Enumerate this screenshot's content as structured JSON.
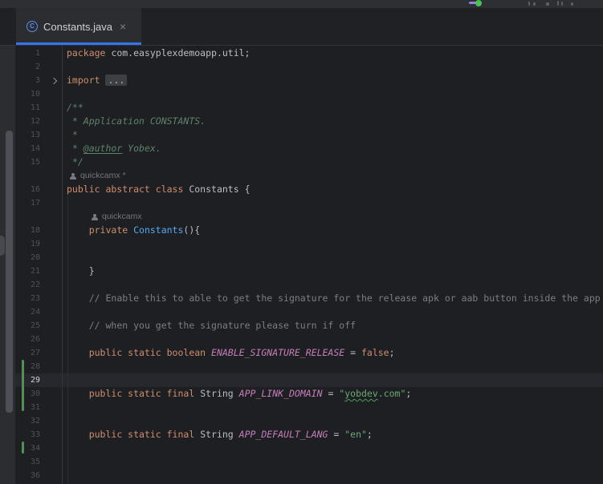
{
  "theme": {
    "accent": "#3574f0",
    "editor_bg": "#1e1f22",
    "panel_bg": "#2b2d30",
    "keyword_color": "#cf8e6d",
    "string_color": "#6aab73",
    "comment_color": "#7a7e85",
    "doc_comment_color": "#5f826b",
    "static_field_color": "#c77dbb",
    "method_color": "#56a8f5",
    "change_marker_color": "#549159",
    "run_dot_color": "#4cc152"
  },
  "tab": {
    "title": "Constants.java",
    "icon_letter": "C",
    "close_glyph": "×"
  },
  "editor": {
    "caret_line": 29,
    "changed_line_ranges": [
      [
        28,
        31
      ],
      [
        34,
        34
      ]
    ],
    "folded_region": "import lines 4-9",
    "rows": [
      {
        "ln": "1",
        "seg": [
          [
            "k",
            "package "
          ],
          [
            "p",
            "com.easyplexdemoapp.util;"
          ]
        ]
      },
      {
        "ln": "2",
        "seg": []
      },
      {
        "ln": "3",
        "fold": true,
        "seg": [
          [
            "k",
            "import "
          ],
          [
            "chip",
            "..."
          ]
        ]
      },
      {
        "ln": "10",
        "seg": []
      },
      {
        "ln": "11",
        "seg": [
          [
            "d",
            "/**"
          ]
        ]
      },
      {
        "ln": "12",
        "seg": [
          [
            "d",
            " * Application CONSTANTS."
          ]
        ]
      },
      {
        "ln": "13",
        "seg": [
          [
            "d",
            " *"
          ]
        ]
      },
      {
        "ln": "14",
        "seg": [
          [
            "d",
            " * "
          ],
          [
            "dt",
            "@author"
          ],
          [
            "d",
            " Yobex."
          ]
        ]
      },
      {
        "ln": "15",
        "seg": [
          [
            "d",
            " */"
          ]
        ]
      },
      {
        "ln": null,
        "inlay": "quickcamx *",
        "indent": 0
      },
      {
        "ln": "16",
        "seg": [
          [
            "k",
            "public abstract class "
          ],
          [
            "p",
            "Constants {"
          ]
        ]
      },
      {
        "ln": "17",
        "seg": []
      },
      {
        "ln": null,
        "inlay": "quickcamx",
        "indent": 1
      },
      {
        "ln": "18",
        "seg": [
          [
            "p",
            "    "
          ],
          [
            "k",
            "private "
          ],
          [
            "fn",
            "Constants"
          ],
          [
            "p",
            "(){"
          ]
        ]
      },
      {
        "ln": "19",
        "seg": []
      },
      {
        "ln": "20",
        "seg": []
      },
      {
        "ln": "21",
        "seg": [
          [
            "p",
            "    }"
          ]
        ]
      },
      {
        "ln": "22",
        "seg": []
      },
      {
        "ln": "23",
        "seg": [
          [
            "p",
            "    "
          ],
          [
            "c",
            "// Enable this to able to get the signature for the release apk or aab button inside the app"
          ]
        ]
      },
      {
        "ln": "24",
        "seg": []
      },
      {
        "ln": "25",
        "seg": [
          [
            "p",
            "    "
          ],
          [
            "c",
            "// when you get the signature please turn if off"
          ]
        ]
      },
      {
        "ln": "26",
        "seg": []
      },
      {
        "ln": "27",
        "seg": [
          [
            "p",
            "    "
          ],
          [
            "k",
            "public static boolean "
          ],
          [
            "f",
            "ENABLE_SIGNATURE_RELEASE"
          ],
          [
            "p",
            " = "
          ],
          [
            "k",
            "false"
          ],
          [
            "p",
            ";"
          ]
        ]
      },
      {
        "ln": "28",
        "seg": []
      },
      {
        "ln": "29",
        "cur": true,
        "seg": []
      },
      {
        "ln": "30",
        "seg": [
          [
            "p",
            "    "
          ],
          [
            "k",
            "public static final "
          ],
          [
            "p",
            "String "
          ],
          [
            "f",
            "APP_LINK_DOMAIN"
          ],
          [
            "p",
            " = "
          ],
          [
            "s",
            "\""
          ],
          [
            "st",
            "yobdev"
          ],
          [
            "s",
            ".com\""
          ],
          [
            "p",
            ";"
          ]
        ]
      },
      {
        "ln": "31",
        "seg": []
      },
      {
        "ln": "32",
        "seg": []
      },
      {
        "ln": "33",
        "seg": [
          [
            "p",
            "    "
          ],
          [
            "k",
            "public static final "
          ],
          [
            "p",
            "String "
          ],
          [
            "f",
            "APP_DEFAULT_LANG"
          ],
          [
            "p",
            " = "
          ],
          [
            "s",
            "\"en\""
          ],
          [
            "p",
            ";"
          ]
        ]
      },
      {
        "ln": "34",
        "seg": []
      },
      {
        "ln": "35",
        "seg": []
      },
      {
        "ln": "36",
        "seg": []
      }
    ]
  }
}
